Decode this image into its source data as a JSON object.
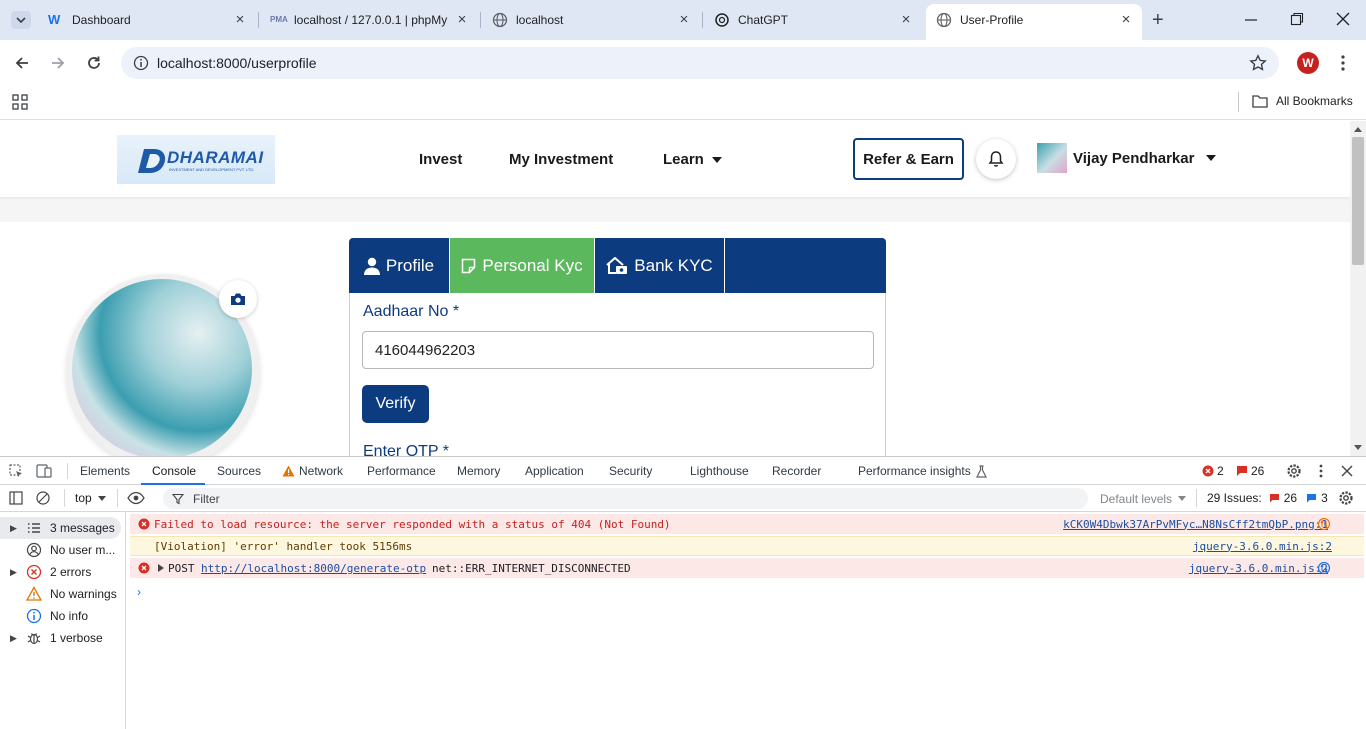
{
  "browser": {
    "tabs": [
      {
        "title": "Dashboard",
        "icon": "dashboard-favicon"
      },
      {
        "title": "localhost / 127.0.0.1 | phpMy",
        "icon": "phpmyadmin-favicon"
      },
      {
        "title": "localhost",
        "icon": "globe-favicon"
      },
      {
        "title": "ChatGPT",
        "icon": "chatgpt-favicon"
      },
      {
        "title": "User-Profile",
        "icon": "globe-favicon",
        "active": true
      }
    ],
    "url": "localhost:8000/userprofile",
    "profile_initial": "W",
    "bookmarks_label": "All Bookmarks"
  },
  "site": {
    "logo_text": "DHARAMAI",
    "logo_subtext": "INVESTMENT AND DEVELOPMENT PVT. LTD.",
    "nav": [
      "Invest",
      "My Investment",
      "Learn"
    ],
    "refer_label": "Refer & Earn",
    "user_name": "Vijay Pendharkar",
    "kyc_tabs": [
      "Profile",
      "Personal Kyc",
      "Bank KYC"
    ],
    "aadhaar_label": "Aadhaar No *",
    "aadhaar_value": "416044962203",
    "verify_label": "Verify",
    "otp_label": "Enter OTP *",
    "colors": {
      "navy": "#0d3b80",
      "green": "#5cb85c"
    }
  },
  "devtools": {
    "tabs": [
      "Elements",
      "Console",
      "Sources",
      "Network",
      "Performance",
      "Memory",
      "Application",
      "Security",
      "Lighthouse",
      "Recorder",
      "Performance insights"
    ],
    "active_tab": "Console",
    "error_count": "2",
    "issue_count": "26",
    "context": "top",
    "filter_placeholder": "Filter",
    "levels": "Default levels",
    "issues_label": "29 Issues:",
    "issues_err": "26",
    "issues_info": "3",
    "sidebar": [
      {
        "label": "3 messages",
        "icon": "list-icon",
        "arrow": true
      },
      {
        "label": "No user m...",
        "icon": "user-icon",
        "arrow": false
      },
      {
        "label": "2 errors",
        "icon": "error-icon",
        "arrow": true
      },
      {
        "label": "No warnings",
        "icon": "warning-icon",
        "arrow": false
      },
      {
        "label": "No info",
        "icon": "info-icon",
        "arrow": false
      },
      {
        "label": "1 verbose",
        "icon": "bug-icon",
        "arrow": true
      }
    ],
    "messages": [
      {
        "type": "error",
        "text": "Failed to load resource: the server responded with a status of 404 (Not Found)",
        "source": "kCK0W4Dbwk37ArPvMFyc…N8NsCff2tmQbP.png:1"
      },
      {
        "type": "violation",
        "text": "[Violation] 'error' handler took 5156ms",
        "source": "jquery-3.6.0.min.js:2"
      },
      {
        "type": "error",
        "prefix": "POST",
        "link": "http://localhost:8000/generate-otp",
        "suffix": "net::ERR_INTERNET_DISCONNECTED",
        "source": "jquery-3.6.0.min.js:2"
      }
    ]
  }
}
